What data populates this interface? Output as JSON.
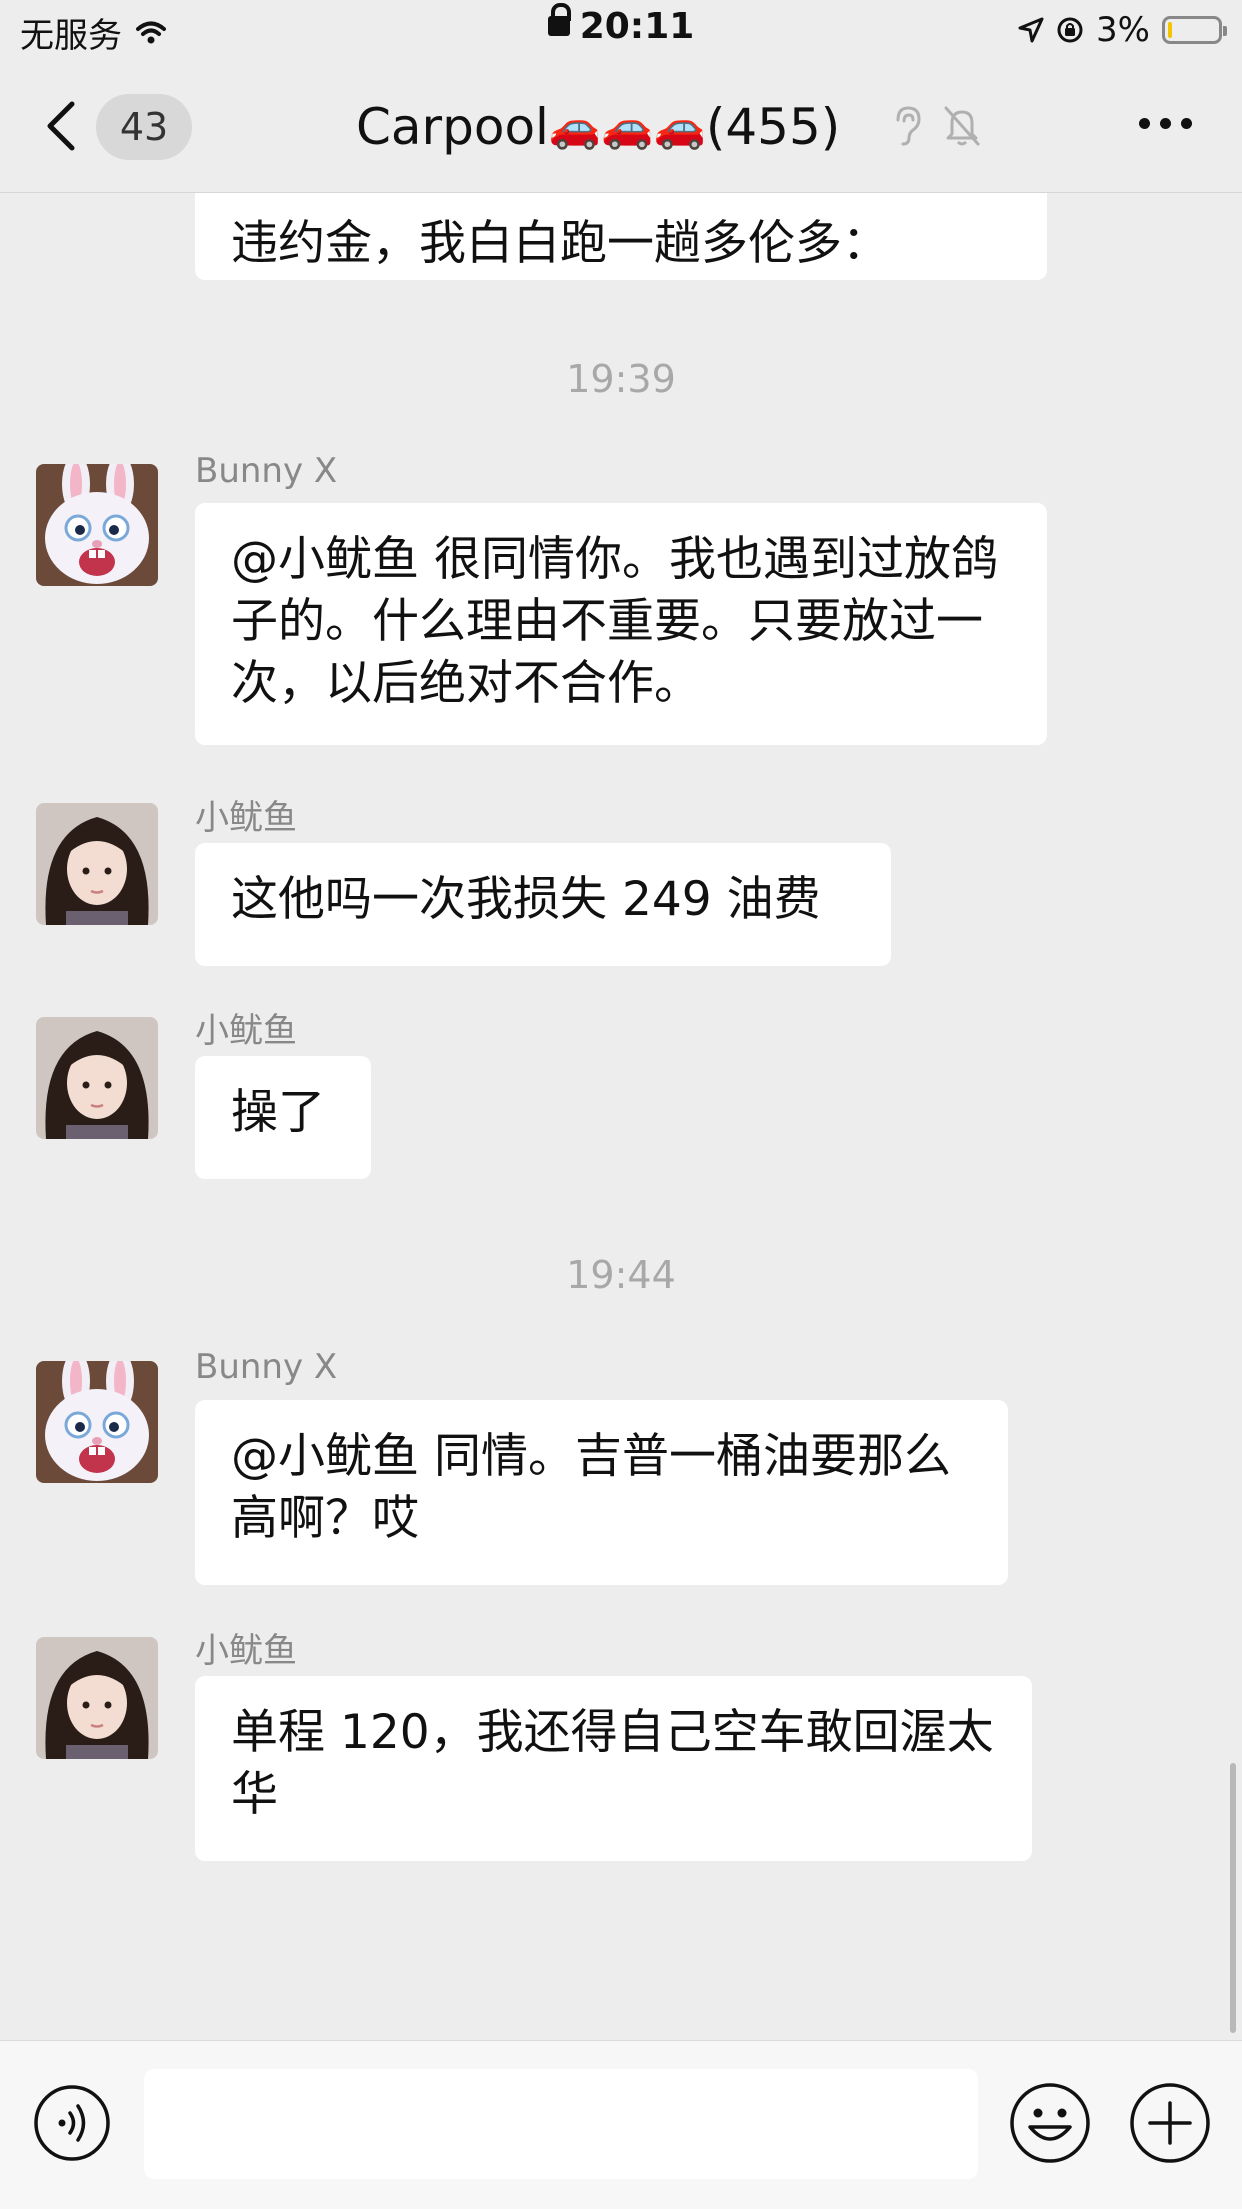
{
  "status_bar": {
    "carrier": "无服务",
    "time": "20:11",
    "battery_percent": "3%",
    "battery_level": 0.03,
    "battery_color": "#f5c400"
  },
  "nav": {
    "unread_count": "43",
    "title": "Carpool",
    "title_emoji": "🚗🚗🚗",
    "member_count": "(455)",
    "icons": [
      "back-chevron-icon",
      "earpiece-icon",
      "mute-bell-icon",
      "more-icon"
    ]
  },
  "chat": {
    "partial_message": "违约金，我白白跑一趟多伦多：",
    "timestamps": [
      "19:39",
      "19:44"
    ],
    "messages": [
      {
        "sender": "Bunny X",
        "avatar": "rabbit-avatar",
        "text": "@小鱿鱼 很同情你。我也遇到过放鸽子的。什么理由不重要。只要放过一次，以后绝对不合作。"
      },
      {
        "sender": "小鱿鱼",
        "avatar": "girl-avatar",
        "text": "这他吗一次我损失 249 油费"
      },
      {
        "sender": "小鱿鱼",
        "avatar": "girl-avatar",
        "text": "操了"
      },
      {
        "sender": "Bunny X",
        "avatar": "rabbit-avatar",
        "text": "@小鱿鱼 同情。吉普一桶油要那么高啊？哎"
      },
      {
        "sender": "小鱿鱼",
        "avatar": "girl-avatar",
        "text": "单程 120，我还得自己空车敢回渥太华"
      }
    ]
  },
  "input_bar": {
    "placeholder": "",
    "icons": [
      "voice-icon",
      "emoji-icon",
      "plus-icon"
    ]
  },
  "colors": {
    "background": "#ededed",
    "bubble": "#ffffff",
    "sender": "#888888",
    "timestamp": "#a8a8a8"
  }
}
